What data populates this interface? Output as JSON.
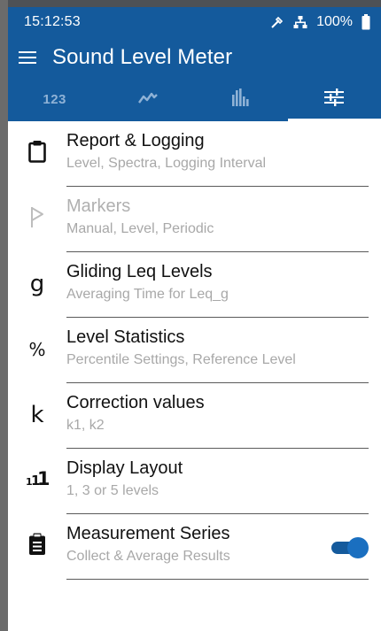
{
  "status": {
    "time": "15:12:53",
    "battery": "100%"
  },
  "header": {
    "title": "Sound Level Meter",
    "tabs": [
      {
        "label": "123",
        "icon": "numeric-tab"
      },
      {
        "icon": "line-chart-icon"
      },
      {
        "icon": "bar-chart-icon"
      },
      {
        "icon": "settings-sliders-icon",
        "active": true
      }
    ]
  },
  "items": [
    {
      "title": "Report & Logging",
      "subtitle": "Level, Spectra, Logging Interval",
      "icon": "clipboard-icon"
    },
    {
      "title": "Markers",
      "subtitle": "Manual, Level, Periodic",
      "icon": "flag-icon",
      "disabled": true
    },
    {
      "title": "Gliding Leq Levels",
      "subtitle": "Averaging Time for Leq_g",
      "icon_glyph": "g"
    },
    {
      "title": "Level Statistics",
      "subtitle": "Percentile Settings, Reference Level",
      "icon_glyph": "%"
    },
    {
      "title": "Correction values",
      "subtitle": "k1, k2",
      "icon_glyph": "k"
    },
    {
      "title": "Display Layout",
      "subtitle": "1, 3 or 5 levels",
      "icon": "layout-levels-icon"
    },
    {
      "title": "Measurement Series",
      "subtitle": "Collect & Average Results",
      "icon": "clipboard-list-icon",
      "toggle": true
    }
  ],
  "colors": {
    "primary": "#145a9c",
    "toggle": "#1a6fc0"
  }
}
